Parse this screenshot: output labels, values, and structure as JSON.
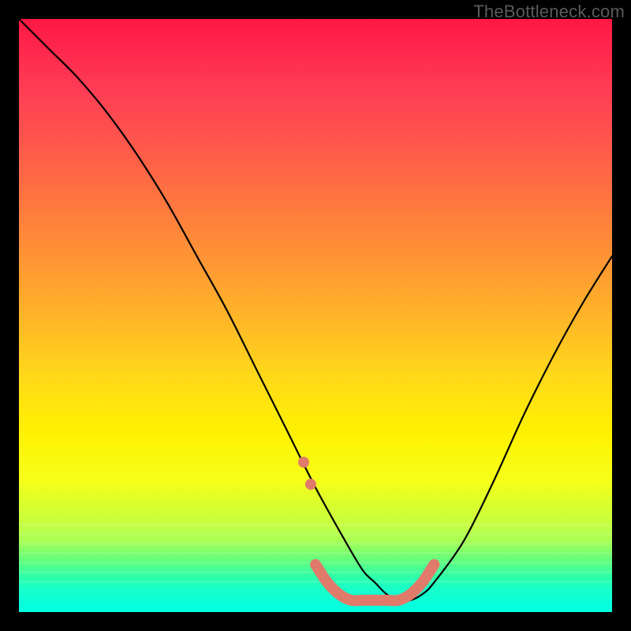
{
  "watermark": "TheBottleneck.com",
  "chart_data": {
    "type": "line",
    "title": "",
    "xlabel": "",
    "ylabel": "",
    "xlim": [
      0,
      100
    ],
    "ylim": [
      0,
      100
    ],
    "grid": false,
    "legend": false,
    "series": [
      {
        "name": "black-curve",
        "color": "#000000",
        "x": [
          0,
          5,
          10,
          15,
          20,
          25,
          30,
          35,
          40,
          45,
          50,
          55,
          58,
          60,
          62,
          64,
          66,
          68,
          70,
          75,
          80,
          85,
          90,
          95,
          100
        ],
        "values": [
          100,
          95,
          90,
          84,
          77,
          69,
          60,
          51,
          41,
          31,
          21,
          12,
          7,
          5,
          3,
          2,
          2,
          3,
          5,
          12,
          22,
          33,
          43,
          52,
          60
        ]
      },
      {
        "name": "salmon-plateau",
        "color": "#e07a6a",
        "x": [
          50,
          52,
          54,
          56,
          58,
          60,
          62,
          64,
          66,
          68,
          70
        ],
        "values": [
          8,
          5,
          3,
          2,
          2,
          2,
          2,
          2,
          3,
          5,
          8
        ]
      }
    ],
    "background_gradient": {
      "top": "#ff1744",
      "mid": "#fff200",
      "bottom": "#00ffc8"
    }
  }
}
